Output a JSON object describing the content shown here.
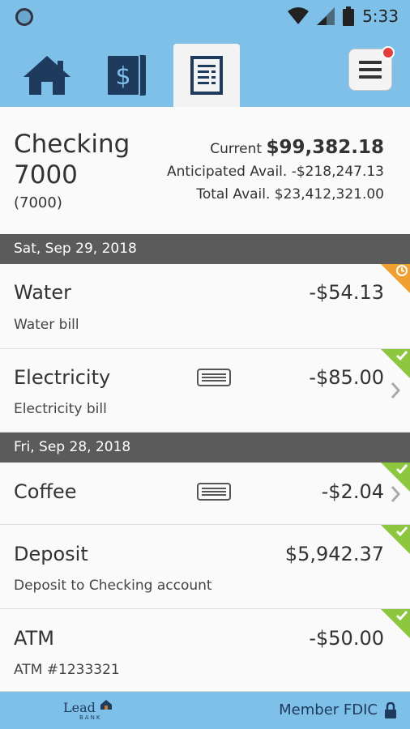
{
  "status": {
    "time": "5:33"
  },
  "nav": {
    "tabs": [
      "home-icon",
      "dollar-statement-icon",
      "register-icon"
    ],
    "active": "register-icon",
    "menu_has_notification": true
  },
  "account": {
    "name": "Checking 7000",
    "number": "(7000)",
    "current_label": "Current",
    "current_value": "$99,382.18",
    "anticipated": "Anticipated Avail. -$218,247.13",
    "total": "Total Avail. $23,412,321.00"
  },
  "groups": [
    {
      "date": "Sat, Sep 29, 2018"
    },
    {
      "date": "Fri, Sep 28, 2018"
    }
  ],
  "transactions": [
    {
      "title": "Water",
      "subtitle": "Water bill",
      "amount": "-$54.13",
      "status": "pending"
    },
    {
      "title": "Electricity",
      "subtitle": "Electricity bill",
      "amount": "-$85.00",
      "status": "cleared"
    },
    {
      "title": "Coffee",
      "subtitle": "",
      "amount": "-$2.04",
      "status": "cleared"
    },
    {
      "title": "Deposit",
      "subtitle": "Deposit to Checking account",
      "amount": "$5,942.37",
      "status": "cleared"
    },
    {
      "title": "ATM",
      "subtitle": "ATM #1233321",
      "amount": "-$50.00",
      "status": "cleared"
    }
  ],
  "footer": {
    "logo": "Lead",
    "logo_sub": "BANK",
    "member": "Member FDIC"
  },
  "colors": {
    "header": "#7ec0e8",
    "navy": "#1e3a5c",
    "cleared": "#8dc63f",
    "pending": "#f0a030",
    "date_bar": "#5b5b5b"
  }
}
